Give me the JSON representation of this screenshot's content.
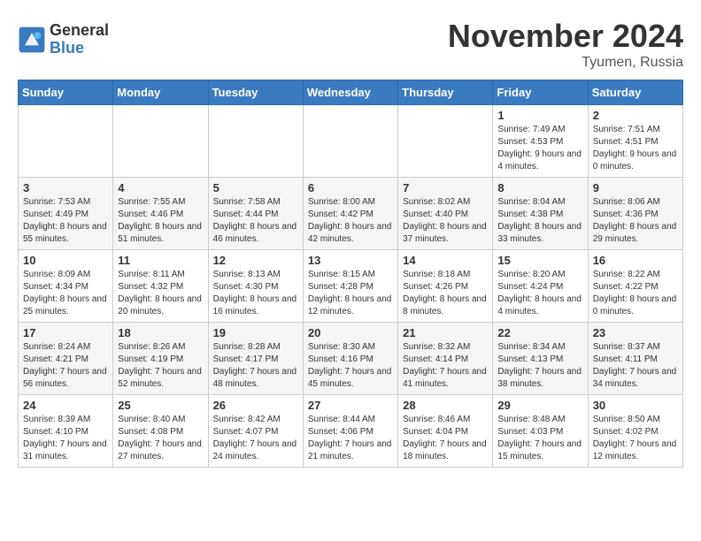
{
  "logo": {
    "general": "General",
    "blue": "Blue"
  },
  "title": "November 2024",
  "location": "Tyumen, Russia",
  "days_header": [
    "Sunday",
    "Monday",
    "Tuesday",
    "Wednesday",
    "Thursday",
    "Friday",
    "Saturday"
  ],
  "weeks": [
    [
      {
        "day": "",
        "info": ""
      },
      {
        "day": "",
        "info": ""
      },
      {
        "day": "",
        "info": ""
      },
      {
        "day": "",
        "info": ""
      },
      {
        "day": "",
        "info": ""
      },
      {
        "day": "1",
        "info": "Sunrise: 7:49 AM\nSunset: 4:53 PM\nDaylight: 9 hours\nand 4 minutes."
      },
      {
        "day": "2",
        "info": "Sunrise: 7:51 AM\nSunset: 4:51 PM\nDaylight: 9 hours\nand 0 minutes."
      }
    ],
    [
      {
        "day": "3",
        "info": "Sunrise: 7:53 AM\nSunset: 4:49 PM\nDaylight: 8 hours\nand 55 minutes."
      },
      {
        "day": "4",
        "info": "Sunrise: 7:55 AM\nSunset: 4:46 PM\nDaylight: 8 hours\nand 51 minutes."
      },
      {
        "day": "5",
        "info": "Sunrise: 7:58 AM\nSunset: 4:44 PM\nDaylight: 8 hours\nand 46 minutes."
      },
      {
        "day": "6",
        "info": "Sunrise: 8:00 AM\nSunset: 4:42 PM\nDaylight: 8 hours\nand 42 minutes."
      },
      {
        "day": "7",
        "info": "Sunrise: 8:02 AM\nSunset: 4:40 PM\nDaylight: 8 hours\nand 37 minutes."
      },
      {
        "day": "8",
        "info": "Sunrise: 8:04 AM\nSunset: 4:38 PM\nDaylight: 8 hours\nand 33 minutes."
      },
      {
        "day": "9",
        "info": "Sunrise: 8:06 AM\nSunset: 4:36 PM\nDaylight: 8 hours\nand 29 minutes."
      }
    ],
    [
      {
        "day": "10",
        "info": "Sunrise: 8:09 AM\nSunset: 4:34 PM\nDaylight: 8 hours\nand 25 minutes."
      },
      {
        "day": "11",
        "info": "Sunrise: 8:11 AM\nSunset: 4:32 PM\nDaylight: 8 hours\nand 20 minutes."
      },
      {
        "day": "12",
        "info": "Sunrise: 8:13 AM\nSunset: 4:30 PM\nDaylight: 8 hours\nand 16 minutes."
      },
      {
        "day": "13",
        "info": "Sunrise: 8:15 AM\nSunset: 4:28 PM\nDaylight: 8 hours\nand 12 minutes."
      },
      {
        "day": "14",
        "info": "Sunrise: 8:18 AM\nSunset: 4:26 PM\nDaylight: 8 hours\nand 8 minutes."
      },
      {
        "day": "15",
        "info": "Sunrise: 8:20 AM\nSunset: 4:24 PM\nDaylight: 8 hours\nand 4 minutes."
      },
      {
        "day": "16",
        "info": "Sunrise: 8:22 AM\nSunset: 4:22 PM\nDaylight: 8 hours\nand 0 minutes."
      }
    ],
    [
      {
        "day": "17",
        "info": "Sunrise: 8:24 AM\nSunset: 4:21 PM\nDaylight: 7 hours\nand 56 minutes."
      },
      {
        "day": "18",
        "info": "Sunrise: 8:26 AM\nSunset: 4:19 PM\nDaylight: 7 hours\nand 52 minutes."
      },
      {
        "day": "19",
        "info": "Sunrise: 8:28 AM\nSunset: 4:17 PM\nDaylight: 7 hours\nand 48 minutes."
      },
      {
        "day": "20",
        "info": "Sunrise: 8:30 AM\nSunset: 4:16 PM\nDaylight: 7 hours\nand 45 minutes."
      },
      {
        "day": "21",
        "info": "Sunrise: 8:32 AM\nSunset: 4:14 PM\nDaylight: 7 hours\nand 41 minutes."
      },
      {
        "day": "22",
        "info": "Sunrise: 8:34 AM\nSunset: 4:13 PM\nDaylight: 7 hours\nand 38 minutes."
      },
      {
        "day": "23",
        "info": "Sunrise: 8:37 AM\nSunset: 4:11 PM\nDaylight: 7 hours\nand 34 minutes."
      }
    ],
    [
      {
        "day": "24",
        "info": "Sunrise: 8:39 AM\nSunset: 4:10 PM\nDaylight: 7 hours\nand 31 minutes."
      },
      {
        "day": "25",
        "info": "Sunrise: 8:40 AM\nSunset: 4:08 PM\nDaylight: 7 hours\nand 27 minutes."
      },
      {
        "day": "26",
        "info": "Sunrise: 8:42 AM\nSunset: 4:07 PM\nDaylight: 7 hours\nand 24 minutes."
      },
      {
        "day": "27",
        "info": "Sunrise: 8:44 AM\nSunset: 4:06 PM\nDaylight: 7 hours\nand 21 minutes."
      },
      {
        "day": "28",
        "info": "Sunrise: 8:46 AM\nSunset: 4:04 PM\nDaylight: 7 hours\nand 18 minutes."
      },
      {
        "day": "29",
        "info": "Sunrise: 8:48 AM\nSunset: 4:03 PM\nDaylight: 7 hours\nand 15 minutes."
      },
      {
        "day": "30",
        "info": "Sunrise: 8:50 AM\nSunset: 4:02 PM\nDaylight: 7 hours\nand 12 minutes."
      }
    ]
  ]
}
